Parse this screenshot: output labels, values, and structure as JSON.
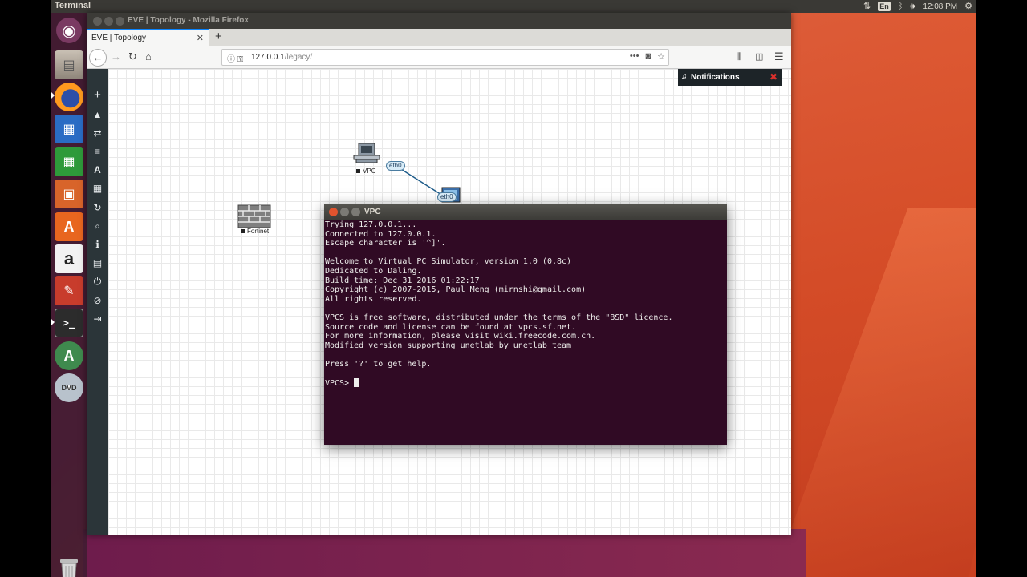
{
  "desktop": {
    "active_app": "Terminal",
    "clock": "12:08 PM",
    "keyboard_layout": "En",
    "accent": "#e95420"
  },
  "launcher": {
    "apps": [
      {
        "name": "ubuntu-dash-icon",
        "glyph": "◉"
      },
      {
        "name": "files-icon",
        "glyph": "▤"
      },
      {
        "name": "firefox-icon",
        "glyph": "●"
      },
      {
        "name": "libreoffice-writer-icon",
        "glyph": "▦"
      },
      {
        "name": "libreoffice-calc-icon",
        "glyph": "▦"
      },
      {
        "name": "libreoffice-impress-icon",
        "glyph": "▣"
      },
      {
        "name": "software-center-icon",
        "glyph": "A"
      },
      {
        "name": "amazon-icon",
        "glyph": "a"
      },
      {
        "name": "system-settings-icon",
        "glyph": "✎"
      },
      {
        "name": "terminal-icon",
        "glyph": ">_"
      },
      {
        "name": "software-updater-icon",
        "glyph": "A"
      },
      {
        "name": "dvd-icon",
        "glyph": "DVD"
      }
    ]
  },
  "browser": {
    "window_title": "EVE | Topology - Mozilla Firefox",
    "tab_title": "EVE | Topology",
    "url_host": "127.0.0.1",
    "url_path": "/legacy/"
  },
  "eve": {
    "notifications_label": "Notifications",
    "nodes": [
      {
        "label": "VPC"
      },
      {
        "label": "Fortinet"
      }
    ],
    "interfaces": [
      "eth0",
      "eth0"
    ]
  },
  "terminal": {
    "title": "VPC",
    "lines": [
      "Trying 127.0.0.1...",
      "Connected to 127.0.0.1.",
      "Escape character is '^]'.",
      "",
      "Welcome to Virtual PC Simulator, version 1.0 (0.8c)",
      "Dedicated to Daling.",
      "Build time: Dec 31 2016 01:22:17",
      "Copyright (c) 2007-2015, Paul Meng (mirnshi@gmail.com)",
      "All rights reserved.",
      "",
      "VPCS is free software, distributed under the terms of the \"BSD\" licence.",
      "Source code and license can be found at vpcs.sf.net.",
      "For more information, please visit wiki.freecode.com.cn.",
      "Modified version supporting unetlab by unetlab team",
      "",
      "Press '?' to get help.",
      ""
    ],
    "prompt": "VPCS> "
  }
}
